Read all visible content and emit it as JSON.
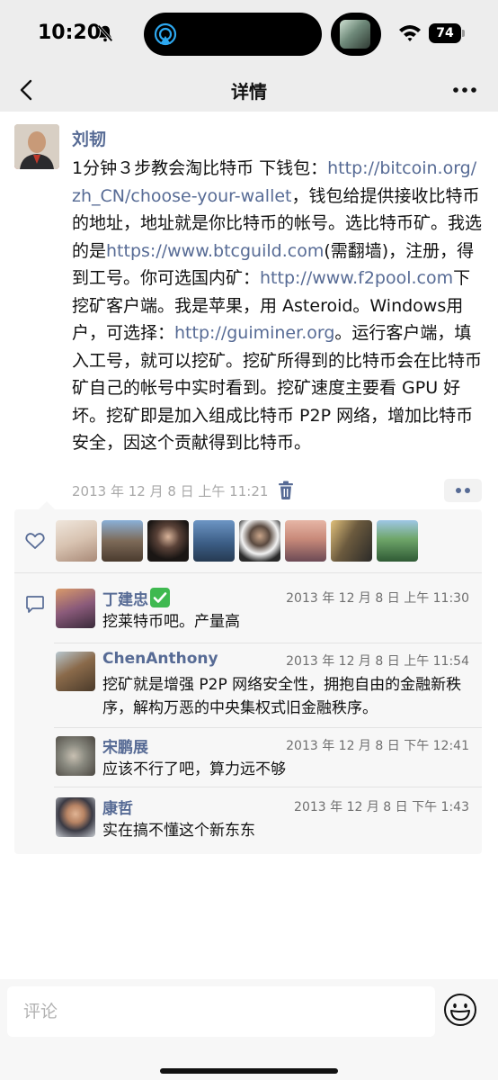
{
  "status_bar": {
    "time": "10:20",
    "battery": "74"
  },
  "nav": {
    "title": "详情",
    "back_icon": "chevron-left-icon",
    "more_icon": "more-horizontal-icon"
  },
  "post": {
    "author": "刘韧",
    "segments": [
      {
        "type": "text",
        "text": "1分钟３步教会淘比特币  下钱包："
      },
      {
        "type": "link",
        "text": "http://bitcoin.org/zh_CN/choose-your-wallet"
      },
      {
        "type": "text",
        "text": "，钱包给提供接收比特币的地址，地址就是你比特币的帐号。选比特币矿。我选的是"
      },
      {
        "type": "link",
        "text": "https://www.btcguild.com"
      },
      {
        "type": "text",
        "text": "(需翻墙)，注册，得到工号。你可选国内矿："
      },
      {
        "type": "link",
        "text": "http://www.f2pool.com"
      },
      {
        "type": "text",
        "text": "下挖矿客户端。我是苹果，用 Asteroid。Windows用户，可选择："
      },
      {
        "type": "link",
        "text": "http://guiminer.org"
      },
      {
        "type": "text",
        "text": "。运行客户端，填入工号，就可以挖矿。挖矿所得到的比特币会在比特币矿自己的帐号中实时看到。挖矿速度主要看 GPU 好坏。挖矿即是加入组成比特币 P2P 网络，增加比特币安全，因这个贡献得到比特币。"
      }
    ],
    "time": "2013 年 12 月 8 日  上午 11:21"
  },
  "likes": {
    "icon": "heart-icon",
    "avatars": [
      "#d9c6b6",
      "#7d6a58",
      "#2a2320",
      "#5a7fa6",
      "#3a3a3a",
      "#c98a7a",
      "#6b5a3e",
      "#4f8a58"
    ]
  },
  "comments": [
    {
      "name": "丁建忠",
      "verified": true,
      "time": "2013 年 12 月 8 日  上午 11:30",
      "text": "挖莱特币吧。产量高",
      "avatar_color": "#8a5a7a"
    },
    {
      "name": "ChenAnthony",
      "verified": false,
      "time": "2013 年 12 月 8 日  上午 11:54",
      "text": "挖矿就是增强 P2P 网络安全性，拥抱自由的金融新秩序，解构万恶的中央集权式旧金融秩序。",
      "avatar_color": "#7a6a4a"
    },
    {
      "name": "宋鹏展",
      "verified": false,
      "time": "2013 年 12 月 8 日  下午 12:41",
      "text": "应该不行了吧，算力远不够",
      "avatar_color": "#8a8a80"
    },
    {
      "name": "康哲",
      "verified": false,
      "time": "2013 年 12 月 8 日  下午 1:43",
      "text": "实在搞不懂这个新东东",
      "avatar_color": "#5a4a3e"
    }
  ],
  "input": {
    "placeholder": "评论"
  }
}
